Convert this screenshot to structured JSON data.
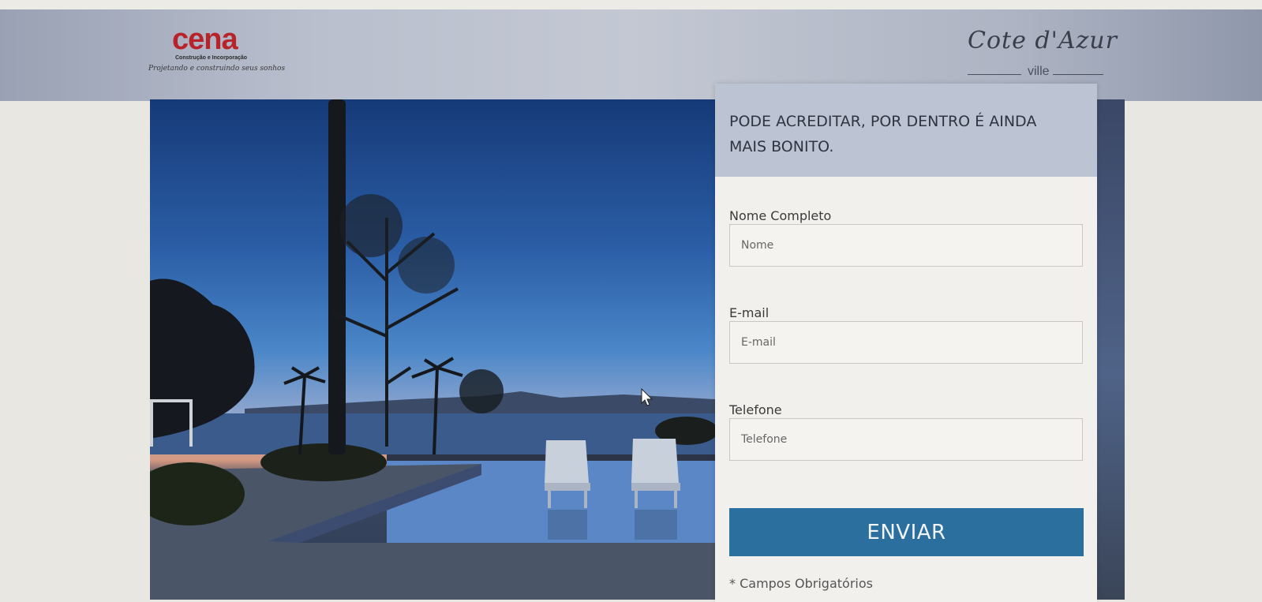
{
  "header": {
    "brand": {
      "name": "cena",
      "subtitle": "Construção e Incorporação",
      "tagline": "Projetando e construindo seus sonhos"
    },
    "project_logo": {
      "name": "Cote d'Azur",
      "sub": "ville"
    }
  },
  "hero": {
    "image": "infinity-pool-sunset-icon"
  },
  "form": {
    "title": "PODE ACREDITAR, POR DENTRO É AINDA MAIS BONITO.",
    "fields": [
      {
        "label": "Nome Completo",
        "placeholder": "Nome",
        "value": ""
      },
      {
        "label": "E-mail",
        "placeholder": "E-mail",
        "value": ""
      },
      {
        "label": "Telefone",
        "placeholder": "Telefone",
        "value": ""
      }
    ],
    "submit_label": "ENVIAR",
    "required_note": "* Campos Obrigatórios"
  },
  "colors": {
    "brand_red": "#b8232a",
    "submit_blue": "#2b6f9e",
    "header_panel": "#bcc3d3"
  },
  "icons": [
    "mouse-pointer-icon",
    "palm-tree-icon",
    "lounge-chair-icon"
  ]
}
